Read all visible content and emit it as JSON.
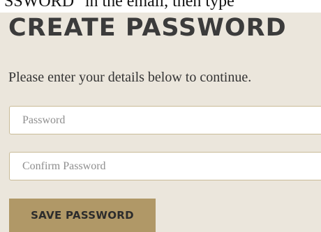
{
  "top_strip": {
    "text": "SSWORD\" in the email, then type"
  },
  "form": {
    "heading": "CREATE PASSWORD",
    "subtitle": "Please enter your details below to continue.",
    "password_placeholder": "Password",
    "confirm_placeholder": "Confirm Password",
    "submit_label": "SAVE PASSWORD"
  },
  "colors": {
    "page_background": "#ebe6dc",
    "button_background": "#b09867",
    "field_border": "#c9bb97",
    "heading_text": "#3b3b3b"
  }
}
